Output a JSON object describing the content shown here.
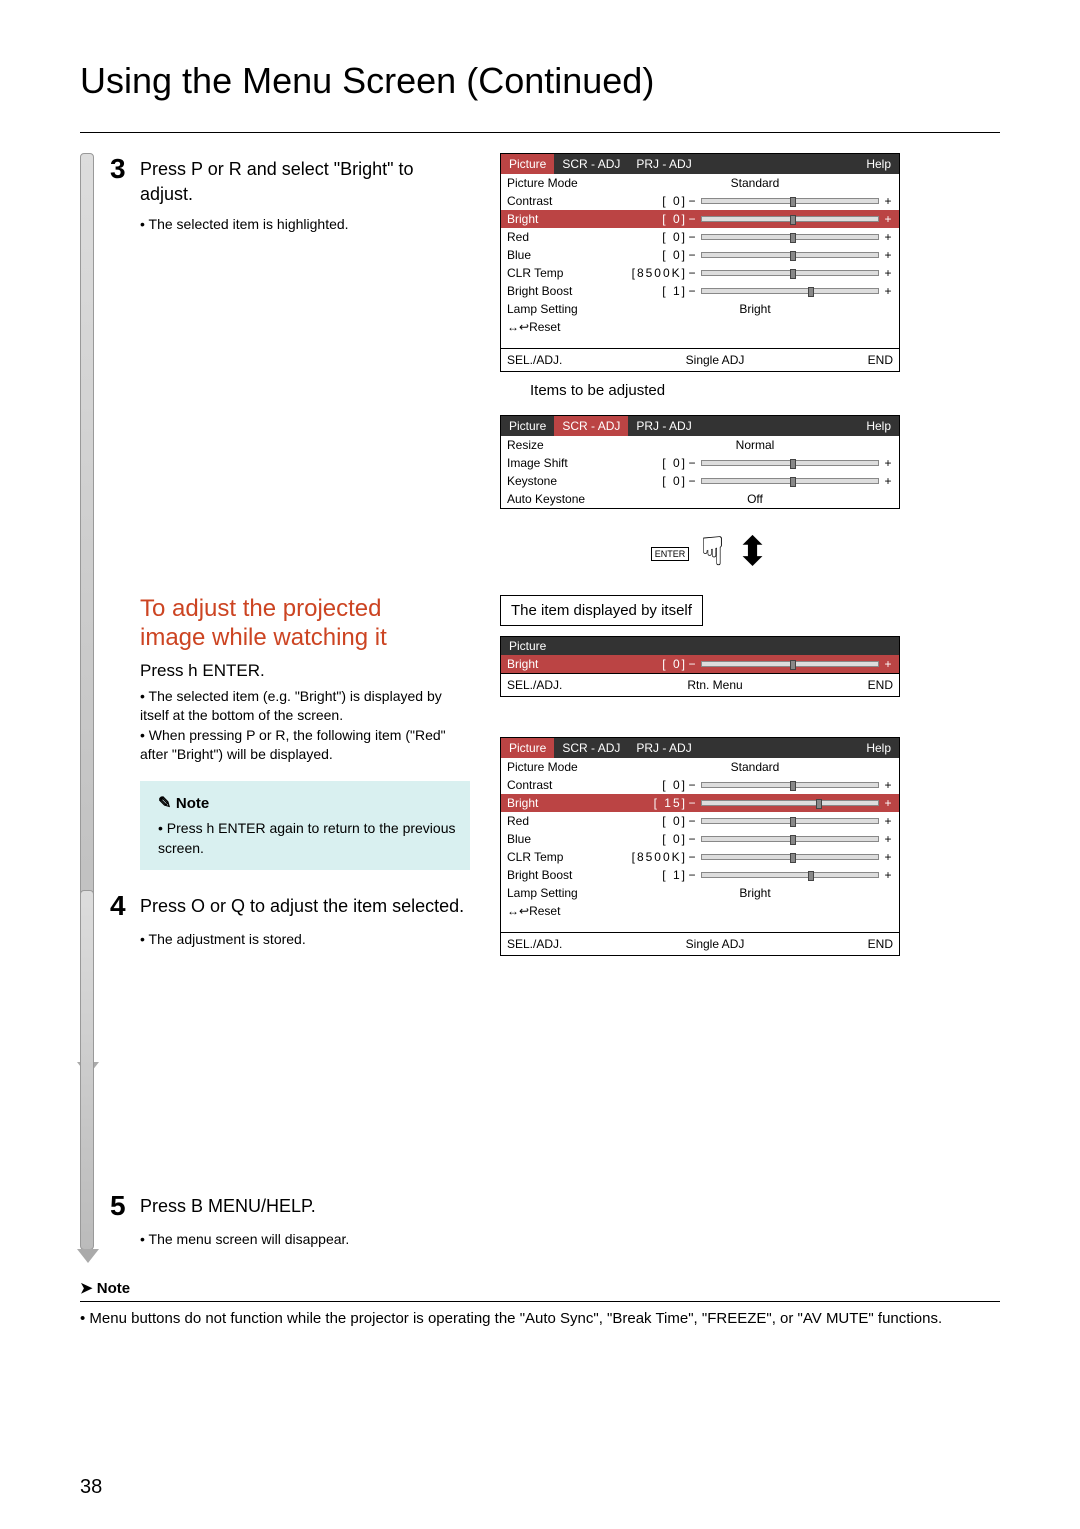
{
  "page": {
    "title": "Using the Menu Screen (Continued)",
    "number": "38"
  },
  "steps": {
    "s3": {
      "num": "3",
      "text_a": "Press P or R and select \"Bright\" to adjust.",
      "bullet": "The selected item is highlighted."
    },
    "section": {
      "title1": "To adjust the projected",
      "title2": "image while watching it",
      "sub": "Press h ENTER.",
      "b1": "The selected item (e.g. \"Bright\") is displayed by itself at the bottom of the screen.",
      "b2": "When pressing P or R, the following item (\"Red\" after \"Bright\") will be displayed."
    },
    "note1": {
      "head": "Note",
      "text": "Press h ENTER again to return to the previous screen."
    },
    "s4": {
      "num": "4",
      "text": "Press O or Q to adjust the item selected.",
      "bullet": "The adjustment is stored."
    },
    "s5": {
      "num": "5",
      "text": "Press B MENU/HELP.",
      "bullet": "The menu screen will disappear."
    }
  },
  "bottom_note": {
    "head": "Note",
    "text": "Menu buttons do not function while the projector is operating the \"Auto Sync\", \"Break Time\", \"FREEZE\", or \"AV MUTE\" functions."
  },
  "captions": {
    "items_adjusted": "Items to be adjusted",
    "item_displayed": "The item displayed by itself",
    "enter": "ENTER"
  },
  "menu1": {
    "tabs": {
      "picture": "Picture",
      "scr": "SCR - ADJ",
      "prj": "PRJ - ADJ",
      "help": "Help"
    },
    "rows": {
      "picture_mode": {
        "label": "Picture Mode",
        "value": "Standard"
      },
      "contrast": {
        "label": "Contrast",
        "val": "0"
      },
      "bright": {
        "label": "Bright",
        "val": "0"
      },
      "red": {
        "label": "Red",
        "val": "0"
      },
      "blue": {
        "label": "Blue",
        "val": "0"
      },
      "clr_temp": {
        "label": "CLR Temp",
        "val": "8500K"
      },
      "bright_boost": {
        "label": "Bright Boost",
        "val": "1"
      },
      "lamp": {
        "label": "Lamp Setting",
        "value": "Bright"
      },
      "reset": {
        "label": "Reset"
      }
    },
    "footer": {
      "sel": "SEL./ADJ.",
      "mid": "Single ADJ",
      "end": "END"
    }
  },
  "menu2": {
    "tabs": {
      "picture": "Picture",
      "scr": "SCR - ADJ",
      "prj": "PRJ - ADJ",
      "help": "Help"
    },
    "rows": {
      "resize": {
        "label": "Resize",
        "value": "Normal"
      },
      "image_shift": {
        "label": "Image Shift",
        "val": "0"
      },
      "keystone": {
        "label": "Keystone",
        "val": "0"
      },
      "auto_keystone": {
        "label": "Auto Keystone",
        "value": "Off"
      }
    }
  },
  "menu3": {
    "head": "Picture",
    "bright": {
      "label": "Bright",
      "val": "0"
    },
    "footer": {
      "sel": "SEL./ADJ.",
      "mid": "Rtn. Menu",
      "end": "END"
    }
  },
  "menu4": {
    "tabs": {
      "picture": "Picture",
      "scr": "SCR - ADJ",
      "prj": "PRJ - ADJ",
      "help": "Help"
    },
    "rows": {
      "picture_mode": {
        "label": "Picture Mode",
        "value": "Standard"
      },
      "contrast": {
        "label": "Contrast",
        "val": "0"
      },
      "bright": {
        "label": "Bright",
        "val": "15"
      },
      "red": {
        "label": "Red",
        "val": "0"
      },
      "blue": {
        "label": "Blue",
        "val": "0"
      },
      "clr_temp": {
        "label": "CLR Temp",
        "val": "8500K"
      },
      "bright_boost": {
        "label": "Bright Boost",
        "val": "1"
      },
      "lamp": {
        "label": "Lamp Setting",
        "value": "Bright"
      },
      "reset": {
        "label": "Reset"
      }
    },
    "footer": {
      "sel": "SEL./ADJ.",
      "mid": "Single ADJ",
      "end": "END"
    }
  },
  "slider": {
    "minus": "−",
    "plus": "+",
    "lb": "[",
    "rb": "]"
  },
  "reset_arrows": "↔↩"
}
